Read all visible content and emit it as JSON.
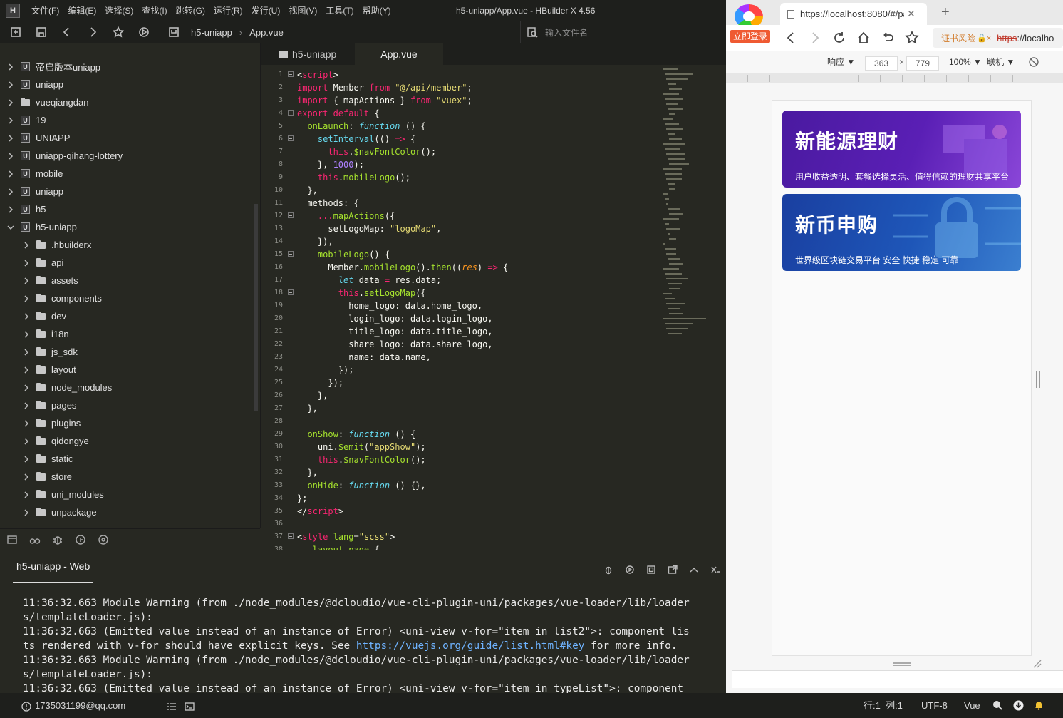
{
  "ide": {
    "menu": [
      "文件(F)",
      "编辑(E)",
      "选择(S)",
      "查找(I)",
      "跳转(G)",
      "运行(R)",
      "发行(U)",
      "视图(V)",
      "工具(T)",
      "帮助(Y)"
    ],
    "window_title": "h5-uniapp/App.vue - HBuilder X 4.56",
    "breadcrumb": [
      "h5-uniapp",
      "App.vue"
    ],
    "file_search_placeholder": "输入文件名",
    "tree": [
      {
        "label": "帝启版本uniapp",
        "type": "project"
      },
      {
        "label": "uniapp",
        "type": "project"
      },
      {
        "label": "vueqiangdan",
        "type": "folder"
      },
      {
        "label": "19",
        "type": "project"
      },
      {
        "label": "UNIAPP",
        "type": "project"
      },
      {
        "label": "uniapp-qihang-lottery",
        "type": "project"
      },
      {
        "label": "mobile",
        "type": "project"
      },
      {
        "label": "uniapp",
        "type": "project"
      },
      {
        "label": "h5",
        "type": "project"
      },
      {
        "label": "h5-uniapp",
        "type": "project",
        "expanded": true
      },
      {
        "label": ".hbuilderx",
        "type": "folder",
        "child": true
      },
      {
        "label": "api",
        "type": "folder",
        "child": true
      },
      {
        "label": "assets",
        "type": "folder",
        "child": true
      },
      {
        "label": "components",
        "type": "folder",
        "child": true
      },
      {
        "label": "dev",
        "type": "folder",
        "child": true
      },
      {
        "label": "i18n",
        "type": "folder",
        "child": true
      },
      {
        "label": "js_sdk",
        "type": "folder",
        "child": true
      },
      {
        "label": "layout",
        "type": "folder",
        "child": true
      },
      {
        "label": "node_modules",
        "type": "folder",
        "child": true
      },
      {
        "label": "pages",
        "type": "folder",
        "child": true
      },
      {
        "label": "plugins",
        "type": "folder",
        "child": true
      },
      {
        "label": "qidongye",
        "type": "folder",
        "child": true
      },
      {
        "label": "static",
        "type": "folder",
        "child": true
      },
      {
        "label": "store",
        "type": "folder",
        "child": true
      },
      {
        "label": "uni_modules",
        "type": "folder",
        "child": true
      },
      {
        "label": "unpackage",
        "type": "folder",
        "child": true
      }
    ],
    "tabs": [
      {
        "label": "h5-uniapp",
        "active": false
      },
      {
        "label": "App.vue",
        "active": true
      }
    ],
    "code_lines": [
      "1",
      "2",
      "3",
      "4",
      "5",
      "6",
      "7",
      "8",
      "9",
      "10",
      "11",
      "12",
      "13",
      "14",
      "15",
      "16",
      "17",
      "18",
      "19",
      "20",
      "21",
      "22",
      "23",
      "24",
      "25",
      "26",
      "27",
      "28",
      "29",
      "30",
      "31",
      "32",
      "33",
      "34",
      "35",
      "36",
      "37",
      "38"
    ],
    "console_tab": "h5-uniapp - Web",
    "console": {
      "l1": "11:36:32.663 Module Warning (from ./node_modules/@dcloudio/vue-cli-plugin-uni/packages/vue-loader/lib/loader",
      "l2": "s/templateLoader.js):",
      "l3": "11:36:32.663 (Emitted value instead of an instance of Error) <uni-view v-for=\"item in list2\">: component lis",
      "l4a": "ts rendered with v-for should have explicit keys. See ",
      "link": "https://vuejs.org/guide/list.html#key",
      "l4b": " for more info.",
      "l5": "11:36:32.663 Module Warning (from ./node_modules/@dcloudio/vue-cli-plugin-uni/packages/vue-loader/lib/loader",
      "l6": "s/templateLoader.js):",
      "l7": "11:36:32.663 (Emitted value instead of an instance of Error) <uni-view v-for=\"item in typeList\">: component"
    },
    "status": {
      "account": "1735031199@qq.com",
      "position": "行:1  列:1",
      "encoding": "UTF-8",
      "language": "Vue"
    }
  },
  "browser": {
    "login_label": "立即登录",
    "tab_title": "https://localhost:8080/#/pa",
    "url_warning": "证书风险",
    "url_https": "https",
    "url_rest": "://localho",
    "device": {
      "mode": "响应 ▼",
      "width": "363",
      "times": "×",
      "height": "779",
      "zoom": "100% ▼",
      "network": "联机 ▼"
    },
    "banners": [
      {
        "title": "新能源理财",
        "subtitle": "用户收益透明、套餐选择灵活、值得信赖的理财共享平台"
      },
      {
        "title": "新币申购",
        "subtitle": "世界级区块链交易平台 安全 快捷 稳定 可靠"
      }
    ]
  }
}
